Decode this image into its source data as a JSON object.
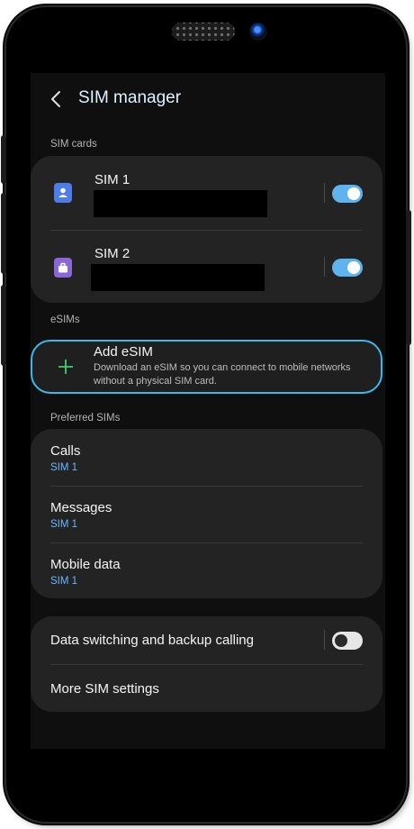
{
  "header": {
    "title": "SIM manager"
  },
  "sim_cards": {
    "section_label": "SIM cards",
    "items": [
      {
        "name": "SIM 1",
        "enabled": true,
        "icon": "person-icon",
        "color": "#4f7de8"
      },
      {
        "name": "SIM 2",
        "enabled": true,
        "icon": "briefcase-icon",
        "color": "#8a67d6"
      }
    ]
  },
  "esims": {
    "section_label": "eSIMs",
    "add_label": "Add eSIM",
    "add_description": "Download an eSIM so you can connect to mobile networks without a physical SIM card.",
    "accent_color": "#3fb7e8"
  },
  "preferred": {
    "section_label": "Preferred SIMs",
    "items": [
      {
        "label": "Calls",
        "value": "SIM 1"
      },
      {
        "label": "Messages",
        "value": "SIM 1"
      },
      {
        "label": "Mobile data",
        "value": "SIM 1"
      }
    ]
  },
  "more": {
    "data_switching_label": "Data switching and backup calling",
    "data_switching_enabled": false,
    "more_settings_label": "More SIM settings"
  }
}
